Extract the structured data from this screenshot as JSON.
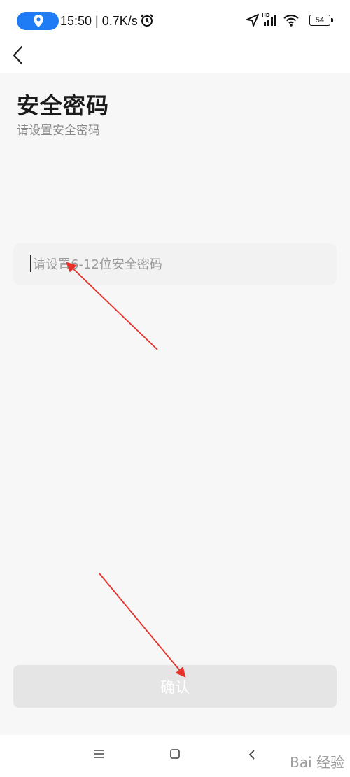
{
  "status_bar": {
    "time_speed": "15:50 | 0.7K/s",
    "battery": "54",
    "icons": [
      "location-pin-icon",
      "alarm-clock-icon",
      "navigation-arrow-icon",
      "hd-signal-icon",
      "wifi-icon",
      "battery-icon"
    ],
    "pill_color": "#1f7cf5"
  },
  "header": {
    "back_icon": "chevron-left-icon"
  },
  "page": {
    "title": "安全密码",
    "subtitle": "请设置安全密码"
  },
  "password": {
    "placeholder": "请设置6-12位安全密码",
    "value": ""
  },
  "confirm": {
    "label": "确认",
    "disabled_color": "#e5e5e5"
  },
  "system_nav": {
    "icons": [
      "menu-icon",
      "home-square-icon",
      "back-triangle-icon"
    ]
  },
  "annotation": {
    "arrow_color": "#e8302a"
  },
  "watermark": {
    "text": "Bai 经验"
  }
}
